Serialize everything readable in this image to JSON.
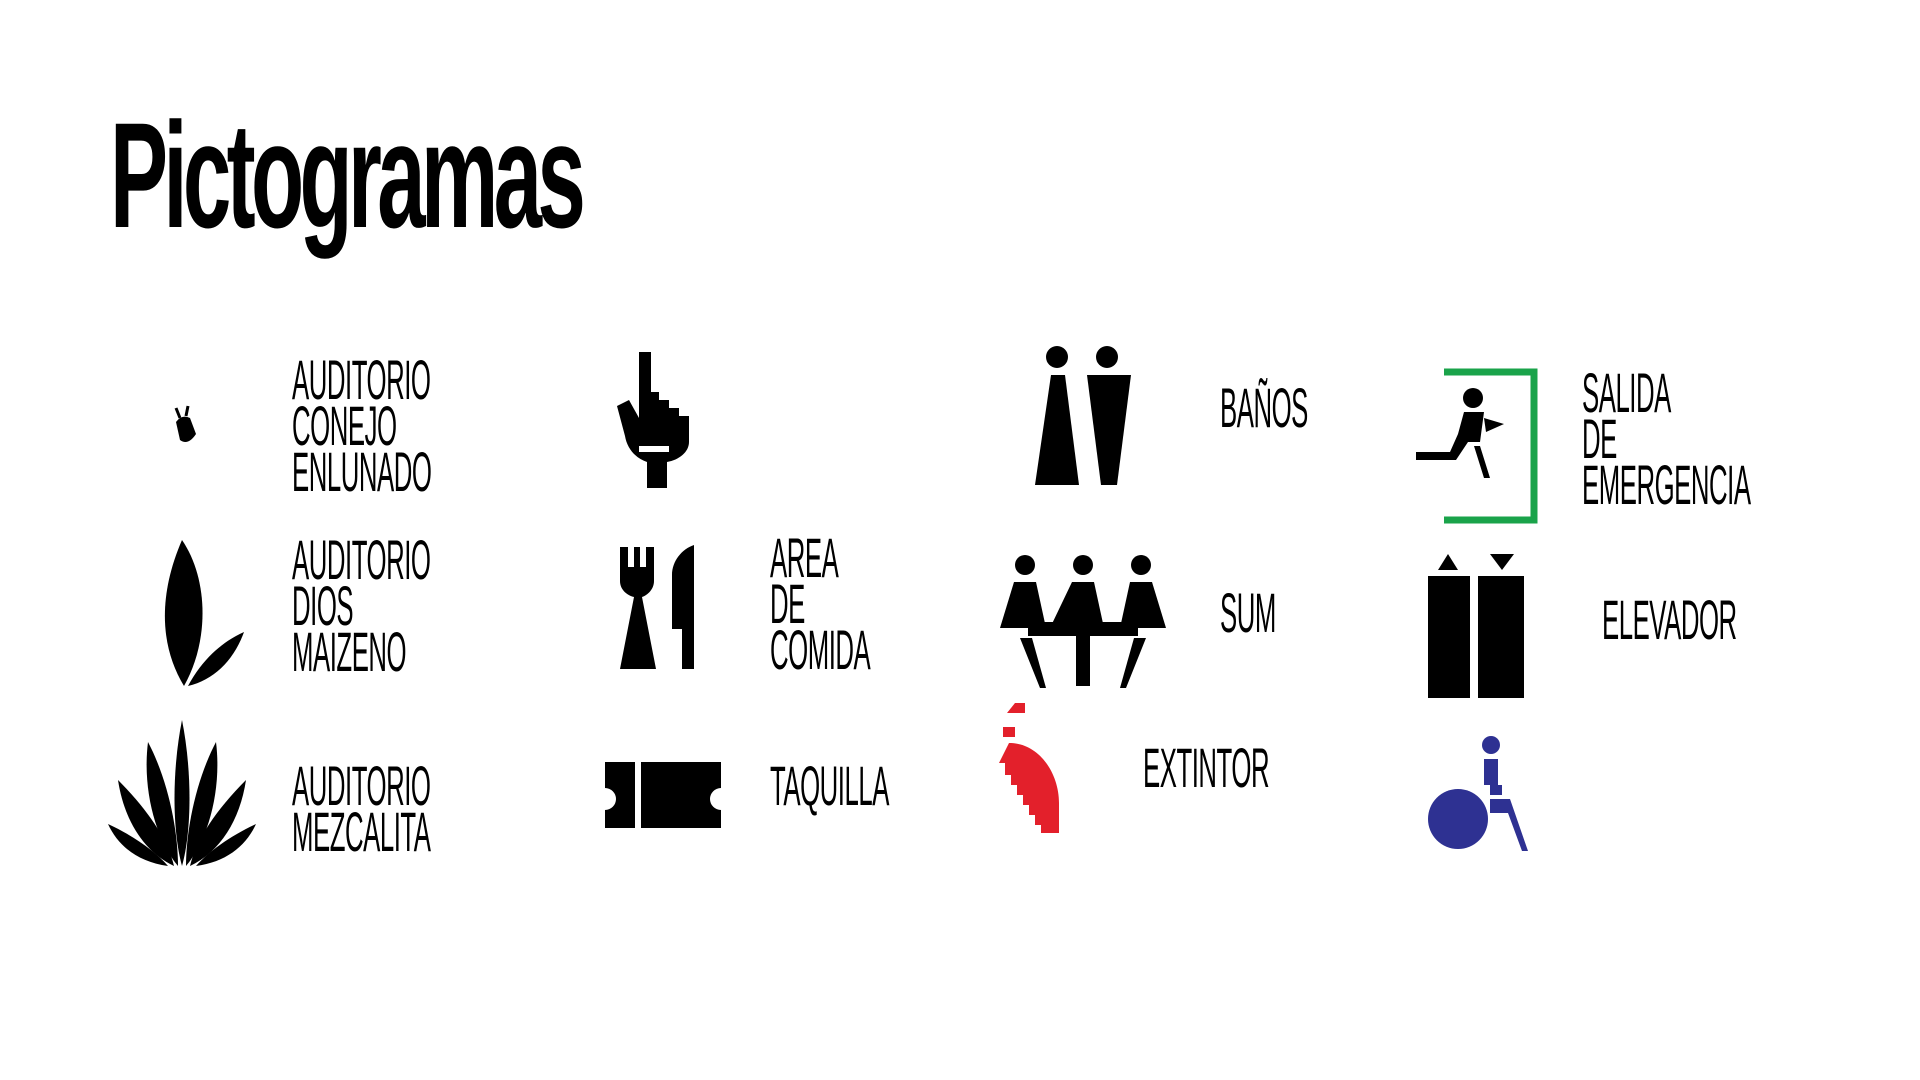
{
  "title": "Pictogramas",
  "colors": {
    "ink": "#000000",
    "exit_green": "#1aa34a",
    "extinguisher_red": "#e3202b",
    "accessible_blue": "#2e3192"
  },
  "items": [
    {
      "icon": "moon-rabbit-icon",
      "label": "AUDITORIO\nCONEJO\nENLUNADO"
    },
    {
      "icon": "corn-leaf-icon",
      "label": "AUDITORIO\nDIOS\nMAIZENO"
    },
    {
      "icon": "agave-icon",
      "label": "AUDITORIO\nMEZCALITA"
    },
    {
      "icon": "pointing-hand-icon",
      "label": ""
    },
    {
      "icon": "fork-knife-icon",
      "label": "AREA\nDE\nCOMIDA"
    },
    {
      "icon": "ticket-icon",
      "label": "TAQUILLA"
    },
    {
      "icon": "restroom-icon",
      "label": "BAÑOS"
    },
    {
      "icon": "meeting-table-icon",
      "label": "SUM"
    },
    {
      "icon": "fire-extinguisher-icon",
      "label": "EXTINTOR"
    },
    {
      "icon": "emergency-exit-icon",
      "label": "SALIDA\nDE\nEMERGENCIA"
    },
    {
      "icon": "elevator-icon",
      "label": "ELEVADOR"
    },
    {
      "icon": "wheelchair-icon",
      "label": ""
    }
  ]
}
